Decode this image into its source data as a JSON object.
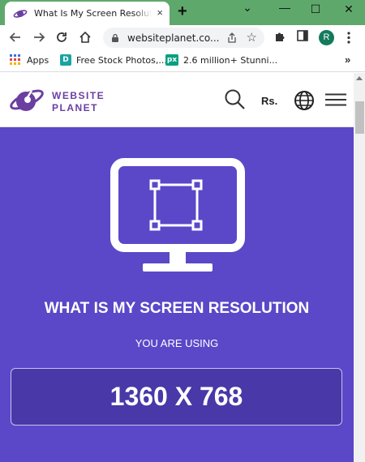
{
  "browser": {
    "tab": {
      "title": "What Is My Screen Resolution",
      "close_glyph": "×"
    },
    "new_tab_glyph": "+",
    "window_controls": {
      "minimize": "⌄",
      "maximize": "—",
      "restore": "☐",
      "close": "✕"
    },
    "address": {
      "url": "websiteplanet.co..."
    },
    "profile_initial": "R",
    "bookmarks": [
      {
        "label": "Apps",
        "icon": "apps-grid-icon"
      },
      {
        "label": "Free Stock Photos,...",
        "icon": "d-icon",
        "glyph": "D",
        "color": "#1aa3a3"
      },
      {
        "label": "2.6 million+ Stunni...",
        "icon": "px-icon",
        "glyph": "px",
        "color": "#05a081"
      }
    ],
    "bookmarks_overflow": "»"
  },
  "site": {
    "logo_line1": "WEBSITE",
    "logo_line2": "PLANET",
    "currency": "Rs.",
    "brand_color": "#6b3fa0"
  },
  "hero": {
    "title": "WHAT IS MY SCREEN RESOLUTION",
    "subtitle": "YOU ARE USING",
    "resolution": "1360 X 768",
    "background": "#5a48c8"
  }
}
